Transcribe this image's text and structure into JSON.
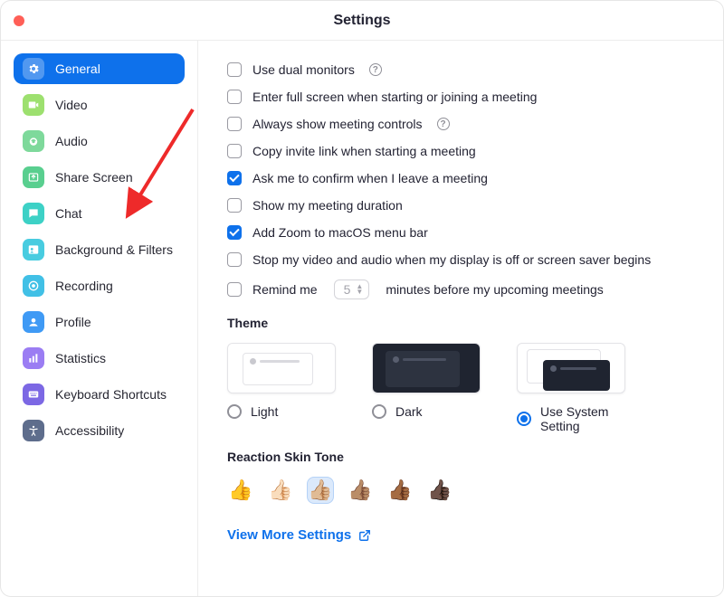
{
  "title": "Settings",
  "sidebar": {
    "items": [
      {
        "label": "General",
        "icon": "gear",
        "bg": "#ffffff47",
        "active": true
      },
      {
        "label": "Video",
        "icon": "video",
        "bg": "#9de06f"
      },
      {
        "label": "Audio",
        "icon": "audio",
        "bg": "#7ed99b"
      },
      {
        "label": "Share Screen",
        "icon": "share",
        "bg": "#59cf8f"
      },
      {
        "label": "Chat",
        "icon": "chat",
        "bg": "#3dd1c6"
      },
      {
        "label": "Background & Filters",
        "icon": "bg",
        "bg": "#48cce0"
      },
      {
        "label": "Recording",
        "icon": "rec",
        "bg": "#41c0e6"
      },
      {
        "label": "Profile",
        "icon": "profile",
        "bg": "#3f9af5"
      },
      {
        "label": "Statistics",
        "icon": "stats",
        "bg": "#9b7df3"
      },
      {
        "label": "Keyboard Shortcuts",
        "icon": "kbd",
        "bg": "#7c68e4"
      },
      {
        "label": "Accessibility",
        "icon": "a11y",
        "bg": "#5e6d8c"
      }
    ]
  },
  "options": [
    {
      "label": "Use dual monitors",
      "checked": false,
      "help": true
    },
    {
      "label": "Enter full screen when starting or joining a meeting",
      "checked": false
    },
    {
      "label": "Always show meeting controls",
      "checked": false,
      "help": true
    },
    {
      "label": "Copy invite link when starting a meeting",
      "checked": false
    },
    {
      "label": "Ask me to confirm when I leave a meeting",
      "checked": true
    },
    {
      "label": "Show my meeting duration",
      "checked": false
    },
    {
      "label": "Add Zoom to macOS menu bar",
      "checked": true
    },
    {
      "label": "Stop my video and audio when my display is off or screen saver begins",
      "checked": false
    }
  ],
  "remind": {
    "prefix": "Remind me",
    "value": "5",
    "suffix": "minutes before my upcoming meetings",
    "checked": false
  },
  "theme_section": "Theme",
  "themes": [
    {
      "label": "Light",
      "selected": false
    },
    {
      "label": "Dark",
      "selected": false
    },
    {
      "label": "Use System Setting",
      "selected": true
    }
  ],
  "skin_section": "Reaction Skin Tone",
  "skins": [
    "👍",
    "👍🏻",
    "👍🏼",
    "👍🏽",
    "👍🏾",
    "👍🏿"
  ],
  "skin_selected_index": 2,
  "view_more": "View More Settings"
}
